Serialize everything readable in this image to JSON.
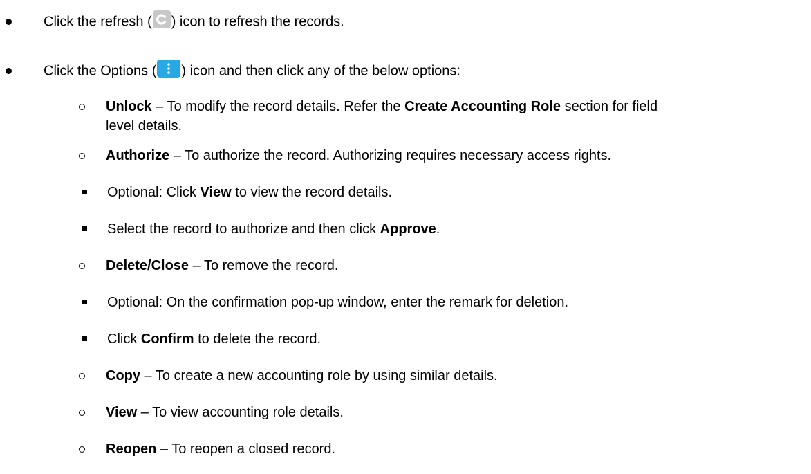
{
  "colors": {
    "refresh_icon_bg": "#c8c8c8",
    "options_icon_bg": "#29a8e6"
  },
  "items": {
    "refresh": {
      "prefix": "Click the refresh (",
      "suffix": ") icon to refresh the records."
    },
    "options": {
      "prefix": "Click the Options (",
      "suffix": ") icon and then click any of the below options:"
    },
    "unlock": {
      "term": "Unlock",
      "desc_a": " – To modify the record details. Refer the ",
      "ref": "Create Accounting Role",
      "desc_b": " section for field",
      "desc_cont": "level details."
    },
    "authorize": {
      "term": "Authorize",
      "desc": " – To authorize the record. Authorizing requires necessary access rights.",
      "sub1_a": "Optional: Click ",
      "sub1_term": "View",
      "sub1_b": " to view the record details.",
      "sub2_a": "Select the record to authorize and then click ",
      "sub2_term": "Approve",
      "sub2_b": "."
    },
    "delete": {
      "term": "Delete/Close",
      "desc": " – To remove the record.",
      "sub1": "Optional: On the confirmation pop-up window, enter the remark for deletion.",
      "sub2_a": "Click ",
      "sub2_term": "Confirm",
      "sub2_b": " to delete the record."
    },
    "copy": {
      "term": "Copy",
      "desc": " – To create a new accounting role by using similar details."
    },
    "view": {
      "term": "View",
      "desc": " – To view accounting role details."
    },
    "reopen": {
      "term": "Reopen",
      "desc": " – To reopen a closed record."
    }
  }
}
